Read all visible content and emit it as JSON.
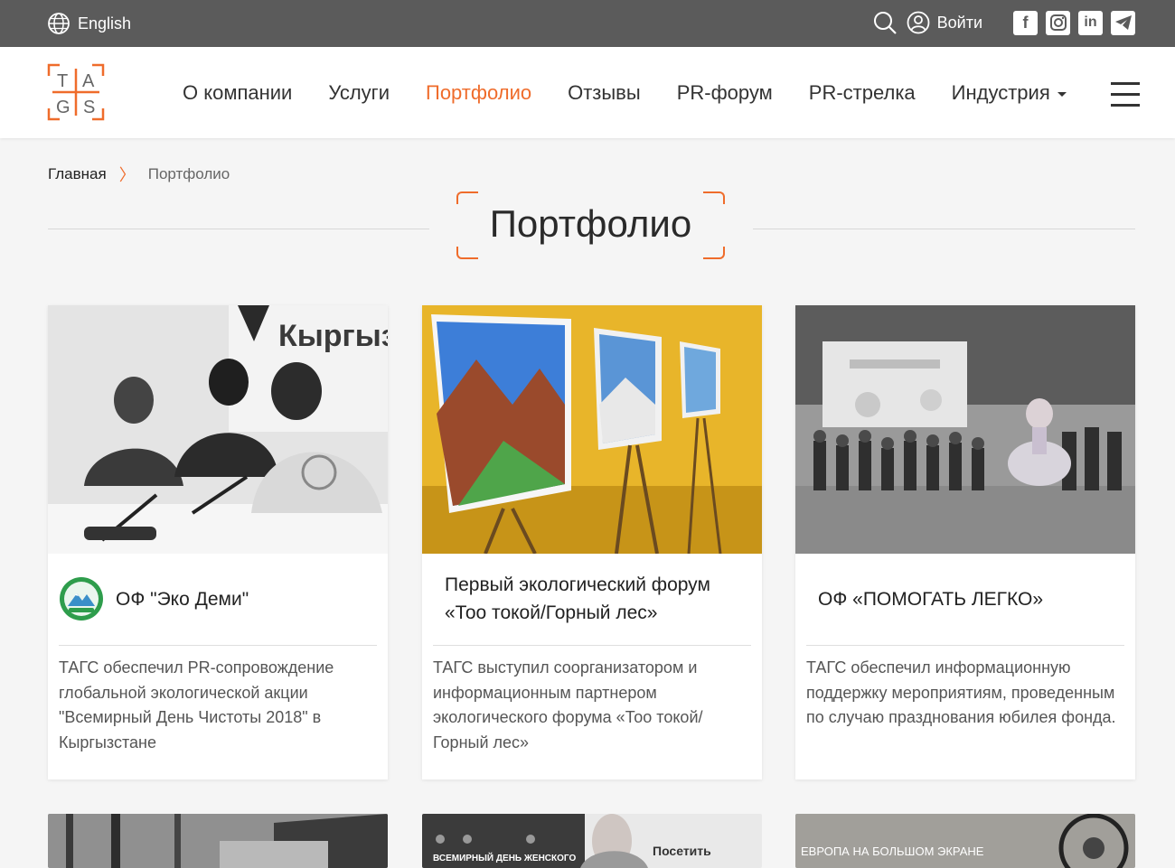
{
  "topbar": {
    "language": "English",
    "login": "Войти",
    "social_icons": [
      "facebook-icon",
      "instagram-icon",
      "linkedin-icon",
      "telegram-icon"
    ]
  },
  "header": {
    "logo_letters": [
      "T",
      "A",
      "G",
      "S"
    ],
    "nav": [
      {
        "label": "О компании"
      },
      {
        "label": "Услуги"
      },
      {
        "label": "Портфолио"
      },
      {
        "label": "Отзывы"
      },
      {
        "label": "PR-форум"
      },
      {
        "label": "PR-стрелка"
      },
      {
        "label": "Индустрия"
      }
    ]
  },
  "breadcrumb": {
    "home": "Главная",
    "separator": "〉",
    "current": "Портфолио"
  },
  "page_title": "Портфолио",
  "cards": [
    {
      "title": "ОФ \"Эко Деми\"",
      "desc": "ТАГС обеспечил PR-сопровождение глобальной экологической акции \"Всемирный День Чистоты 2018\" в Кыргызстане",
      "photo_text": "Кыргызста"
    },
    {
      "title": "Первый экологический форум «Тоо токой/Горный лес»",
      "desc": "ТАГС выступил соорганизатором и информационным партнером экологического форума «Тоо токой/ Горный лес»"
    },
    {
      "title": "ОФ «ПОМОГАТЬ ЛЕГКО»",
      "desc": "ТАГС обеспечил информационную поддержку мероприятиям, проведенным по случаю празднования юбилея фонда."
    }
  ],
  "bottom_cards": [
    {
      "text": ""
    },
    {
      "caption": "ВСЕМИРНЫЙ ДЕНЬ ЖЕНСКОГО",
      "label": "Посетить"
    },
    {
      "caption": "ЕВРОПА НА БОЛЬШОМ ЭКРАНЕ"
    }
  ],
  "colors": {
    "accent": "#ef6c2b",
    "topbar": "#5b5b5b"
  }
}
